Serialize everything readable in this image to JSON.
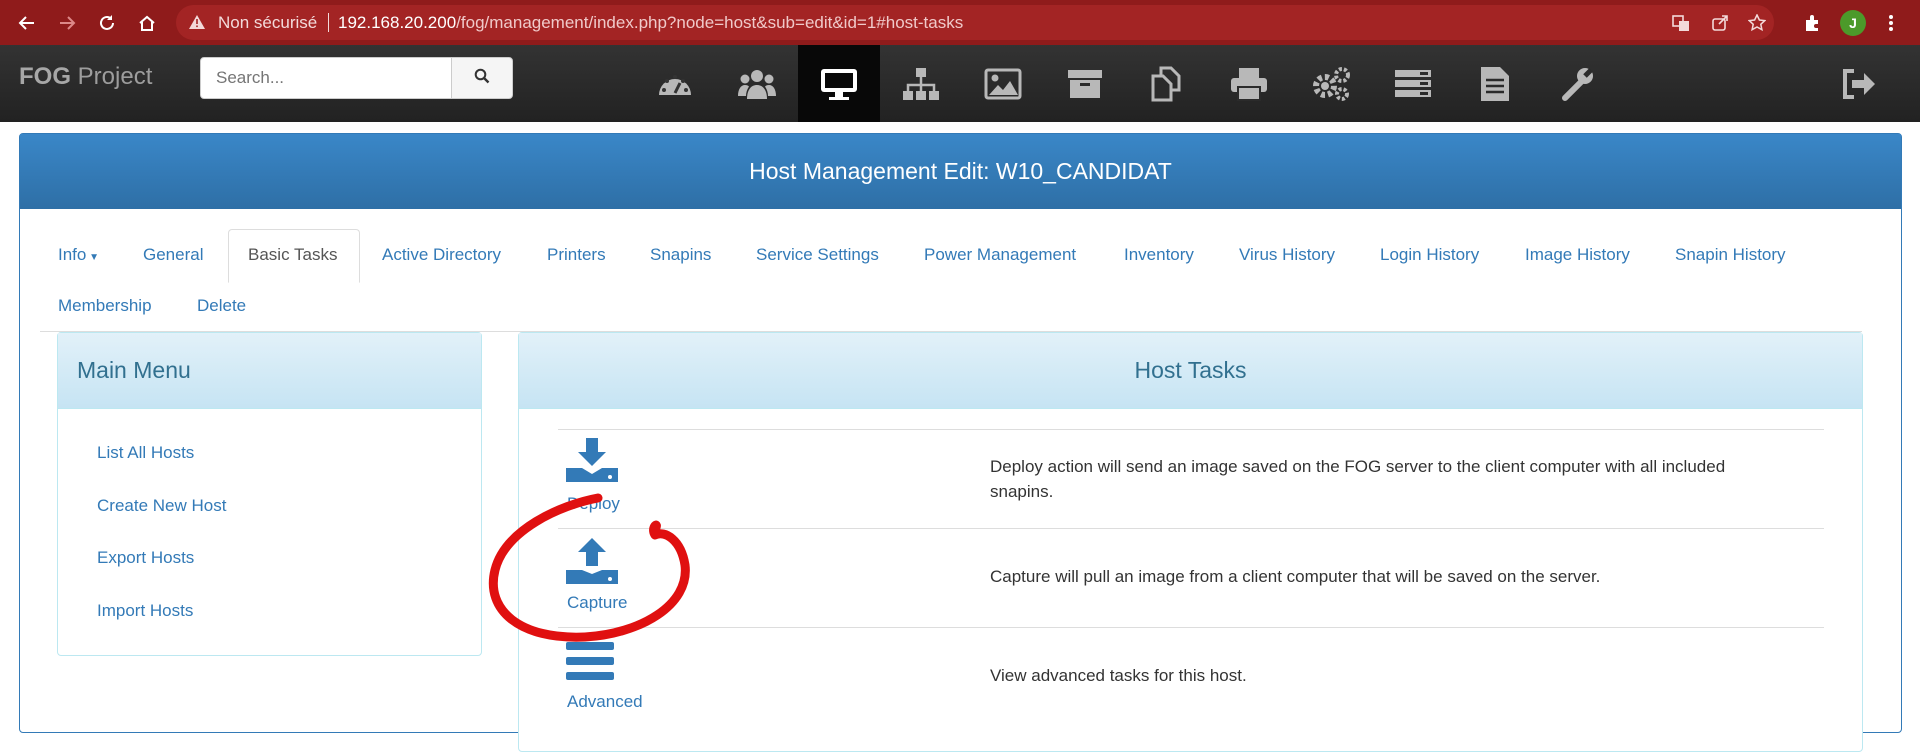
{
  "browser": {
    "security_label": "Non sécurisé",
    "url_host": "192.168.20.200",
    "url_path": "/fog/management/index.php?node=host&sub=edit&id=1#host-tasks",
    "profile_initial": "J"
  },
  "navbar": {
    "brand_bold": "FOG",
    "brand_rest": " Project",
    "search_placeholder": "Search...",
    "icons": [
      "dashboard-icon",
      "users-icon",
      "hosts-icon",
      "groups-icon",
      "images-icon",
      "storage-icon",
      "snapins-icon",
      "printers-icon",
      "services-icon",
      "tasks-icon",
      "reports-icon",
      "settings-icon",
      "logout-icon"
    ],
    "active": "hosts-icon"
  },
  "panel": {
    "title": "Host Management Edit: W10_CANDIDAT"
  },
  "tabs": [
    {
      "label": "Info"
    },
    {
      "label": "General"
    },
    {
      "label": "Basic Tasks"
    },
    {
      "label": "Active Directory"
    },
    {
      "label": "Printers"
    },
    {
      "label": "Snapins"
    },
    {
      "label": "Service Settings"
    },
    {
      "label": "Power Management"
    },
    {
      "label": "Inventory"
    },
    {
      "label": "Virus History"
    },
    {
      "label": "Login History"
    },
    {
      "label": "Image History"
    },
    {
      "label": "Snapin History"
    },
    {
      "label": "Membership"
    },
    {
      "label": "Delete"
    }
  ],
  "active_tab": "Basic Tasks",
  "main_menu": {
    "title": "Main Menu",
    "items": [
      "List All Hosts",
      "Create New Host",
      "Export Hosts",
      "Import Hosts"
    ]
  },
  "host_tasks": {
    "title": "Host Tasks",
    "tasks": [
      {
        "label": "Deploy",
        "icon": "deploy-icon",
        "description": "Deploy action will send an image saved on the FOG server to the client computer with all included snapins."
      },
      {
        "label": "Capture",
        "icon": "capture-icon",
        "description": "Capture will pull an image from a client computer that will be saved on the server."
      },
      {
        "label": "Advanced",
        "icon": "advanced-icon",
        "description": "View advanced tasks for this host."
      }
    ]
  },
  "colors": {
    "chrome_bar": "#8f1b1b",
    "navbar": "#2b2b2b",
    "panel_primary": "#337ab7",
    "info_heading": "#31708f",
    "link": "#337ab7",
    "annotation": "#e01010"
  }
}
